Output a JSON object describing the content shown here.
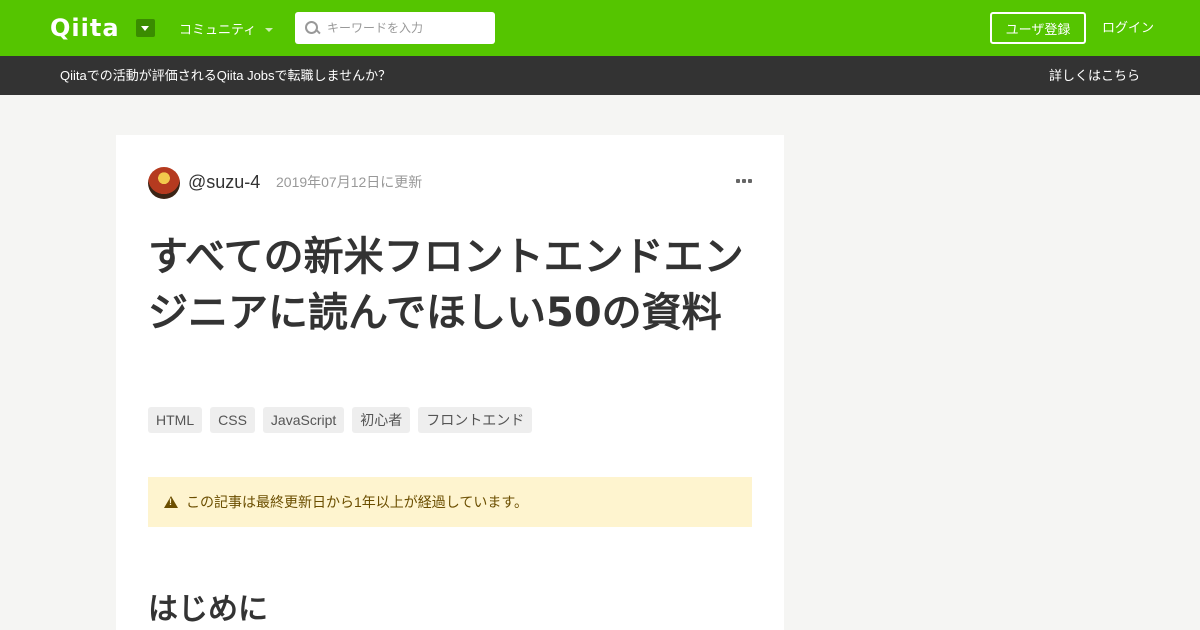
{
  "header": {
    "logo": "Qiita",
    "community_label": "コミュニティ",
    "search_placeholder": "キーワードを入力",
    "signup_label": "ユーザ登録",
    "login_label": "ログイン"
  },
  "banner": {
    "text": "Qiitaでの活動が評価されるQiita Jobsで転職しませんか？",
    "link": "詳しくはこちら"
  },
  "article": {
    "username": "@suzu-4",
    "updated": "2019年07月12日に更新",
    "title": "すべての新米フロントエンドエンジニアに読んでほしい50の資料",
    "tags": [
      "HTML",
      "CSS",
      "JavaScript",
      "初心者",
      "フロントエンド"
    ],
    "notice": "この記事は最終更新日から1年以上が経過しています。",
    "section_heading": "はじめに"
  },
  "colors": {
    "brand": "#55c500",
    "banner_bg": "#333333",
    "notice_bg": "#fef4cf"
  }
}
